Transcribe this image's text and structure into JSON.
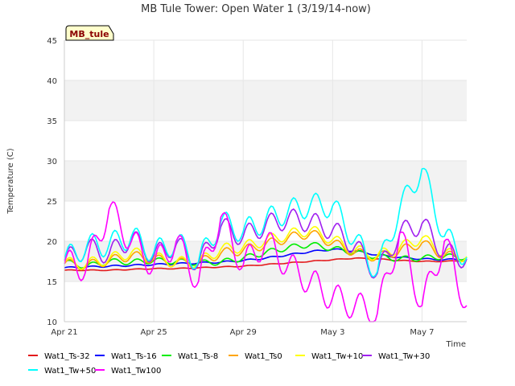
{
  "chart_data": {
    "type": "line",
    "title": "MB Tule Tower: Open Water 1 (3/19/14-now)",
    "xlabel": "Time",
    "ylabel": "Temperature (C)",
    "station_tag": "MB_tule",
    "x_unit": "date",
    "xlim": [
      "2014-04-21",
      "2014-05-09"
    ],
    "ylim": [
      10,
      45
    ],
    "yticks": [
      10,
      15,
      20,
      25,
      30,
      35,
      40,
      45
    ],
    "xticks": [
      {
        "date": "2014-04-21",
        "label": "Apr 21"
      },
      {
        "date": "2014-04-25",
        "label": "Apr 25"
      },
      {
        "date": "2014-04-29",
        "label": "Apr 29"
      },
      {
        "date": "2014-05-03",
        "label": "May 3"
      },
      {
        "date": "2014-05-07",
        "label": "May 7"
      }
    ],
    "grid": true,
    "banded_background": true,
    "legend_position": "bottom",
    "x": [
      "2014-04-21",
      "2014-04-22",
      "2014-04-23",
      "2014-04-24",
      "2014-04-25",
      "2014-04-26",
      "2014-04-27",
      "2014-04-28",
      "2014-04-29",
      "2014-04-30",
      "2014-05-01",
      "2014-05-02",
      "2014-05-03",
      "2014-05-04",
      "2014-05-05",
      "2014-05-06",
      "2014-05-07",
      "2014-05-08",
      "2014-05-09"
    ],
    "series": [
      {
        "name": "Wat1_Ts-32",
        "color": "#e31a1c",
        "values": [
          16.4,
          16.4,
          16.4,
          16.5,
          16.6,
          16.6,
          16.7,
          16.8,
          16.9,
          17.1,
          17.3,
          17.5,
          17.7,
          17.9,
          17.8,
          17.6,
          17.5,
          17.5,
          17.6
        ]
      },
      {
        "name": "Wat1_Ts-16",
        "color": "#0000ff",
        "values": [
          16.7,
          16.8,
          16.9,
          17.0,
          17.1,
          17.2,
          17.3,
          17.4,
          17.6,
          17.9,
          18.3,
          18.7,
          19.0,
          18.8,
          18.3,
          18.0,
          17.8,
          17.7,
          17.8
        ]
      },
      {
        "name": "Wat1_Ts-8",
        "color": "#00ee00",
        "values": [
          17.4,
          16.9,
          17.5,
          17.4,
          17.6,
          17.5,
          17.3,
          17.4,
          17.9,
          18.6,
          19.2,
          19.6,
          19.1,
          18.6,
          18.1,
          17.8,
          17.9,
          18.1,
          18.0
        ]
      },
      {
        "name": "Wat1_Ts0",
        "color": "#ffa500",
        "values": [
          17.2,
          17.0,
          17.6,
          18.2,
          17.8,
          17.3,
          17.3,
          18.5,
          18.9,
          19.6,
          20.4,
          21.0,
          19.8,
          18.6,
          18.0,
          18.8,
          19.8,
          18.2,
          18.0
        ]
      },
      {
        "name": "Wat1_Tw+10",
        "color": "#ffff00",
        "values": [
          17.3,
          17.2,
          17.8,
          18.6,
          18.0,
          17.4,
          17.4,
          19.0,
          19.3,
          20.1,
          20.8,
          21.4,
          20.2,
          18.9,
          18.2,
          19.2,
          20.4,
          18.5,
          18.1
        ]
      },
      {
        "name": "Wat1_Tw+30",
        "color": "#a020f0",
        "values": [
          17.6,
          19.2,
          18.4,
          20.4,
          18.2,
          19.6,
          17.2,
          21.8,
          20.6,
          22.0,
          22.8,
          22.4,
          21.4,
          19.4,
          16.0,
          21.0,
          22.2,
          18.6,
          17.8
        ]
      },
      {
        "name": "Wat1_Tw+50",
        "color": "#00ffff",
        "values": [
          17.7,
          19.4,
          19.6,
          20.6,
          18.6,
          19.9,
          17.5,
          22.4,
          21.2,
          22.6,
          23.7,
          24.5,
          24.4,
          20.2,
          16.2,
          24.0,
          29.0,
          20.6,
          18.0
        ]
      },
      {
        "name": "Wat1_Tw100",
        "color": "#ff00ff",
        "values": [
          17.2,
          16.8,
          24.0,
          20.0,
          17.0,
          20.0,
          15.0,
          23.0,
          17.0,
          20.0,
          17.0,
          15.0,
          13.0,
          12.0,
          11.0,
          21.0,
          12.0,
          20.0,
          12.0
        ]
      }
    ]
  }
}
